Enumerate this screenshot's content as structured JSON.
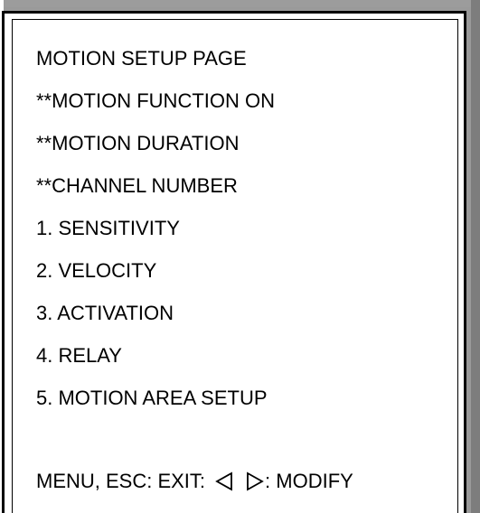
{
  "screen": {
    "title": "MOTION SETUP PAGE",
    "status_lines": [
      "**MOTION FUNCTION ON",
      "**MOTION DURATION",
      "**CHANNEL NUMBER"
    ],
    "menu_items": [
      "1. SENSITIVITY",
      "2. VELOCITY",
      "3. ACTIVATION",
      "4. RELAY",
      "5. MOTION AREA SETUP"
    ],
    "footer": {
      "exit_text": "MENU, ESC: EXIT:",
      "modify_text": ": MODIFY",
      "left_arrow_icon": "left-triangle-icon",
      "right_arrow_icon": "right-triangle-icon"
    }
  }
}
